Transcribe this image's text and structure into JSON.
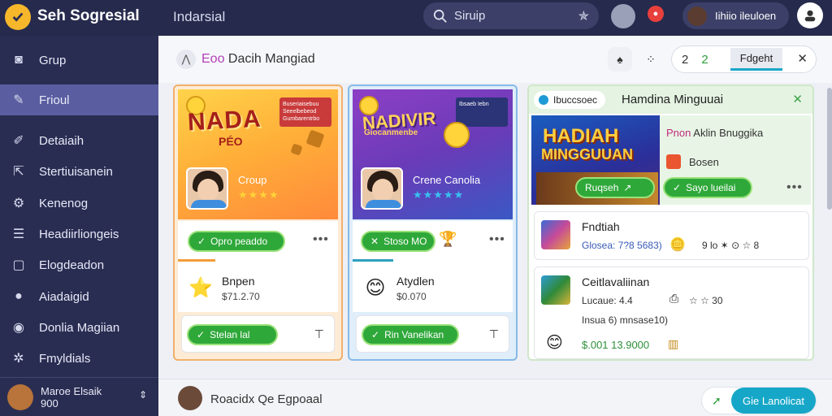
{
  "topbar": {
    "app_title": "Seh Sogresial",
    "breadcrumb": "Indarsial",
    "search_placeholder": "Siruip",
    "user_name": "Iihiio ileuloen"
  },
  "sidebar": {
    "items": [
      {
        "label": "Grup",
        "icon": "camera-icon"
      },
      {
        "label": "Frioul",
        "icon": "pen-icon"
      },
      {
        "label": "Detaiaih",
        "icon": "pencil-icon"
      },
      {
        "label": "Stertiuisanein",
        "icon": "export-icon"
      },
      {
        "label": "Kenenog",
        "icon": "gear-icon"
      },
      {
        "label": "Headiirliongeis",
        "icon": "list-icon"
      },
      {
        "label": "Elogdeadon",
        "icon": "box-icon"
      },
      {
        "label": "Aiadaigid",
        "icon": "drop-icon"
      },
      {
        "label": "Donlia Magiian",
        "icon": "globe-icon"
      },
      {
        "label": "Fmyldials",
        "icon": "settings-icon"
      }
    ],
    "user": {
      "line1": "Maroe Elsaik",
      "line2": "900"
    }
  },
  "header": {
    "prefix": "Eoo",
    "title": "Dacih Mangiad",
    "seg_a": "2",
    "seg_b": "2",
    "seg_tab": "Fdgeht"
  },
  "cards": [
    {
      "banner_word": "NADA",
      "banner_sub": "PÉO",
      "banner_tag": "Buseriaisebuu Seeelbebeod Gumbarentrbo",
      "name": "Croup",
      "stars": "★★★★",
      "action": "Opro peaddo",
      "row_title": "Bnpen",
      "row_value": "$71.2.70",
      "foot_action": "Stelan lal",
      "accent": "#f29d39"
    },
    {
      "banner_word": "NADIVIR",
      "banner_sub": "Giocanmenbe",
      "banner_tag": "Ibsaeb Iebn",
      "name": "Crene Canolia",
      "stars": "★★★★★",
      "action": "Stoso MO",
      "row_title": "Atydlen",
      "row_value": "$0.070",
      "foot_action": "Rin Vanelikan",
      "accent": "#2d9fc0"
    }
  ],
  "card3": {
    "chip": "Ibuccsoec",
    "title": "Hamdina Minguuai",
    "banner_w1": "HADIAH",
    "banner_w2": "MINGGUUAN",
    "panel_line1_a": "Pnon",
    "panel_line1_b": "Aklin Bnuggika",
    "panel_line2": "Bosen",
    "panel_btn_a": "Ruqseh",
    "panel_btn_b": "Sayo lueilai",
    "row1": {
      "title": "Fndtiah",
      "sub": "Glosea: 7?8 5683)",
      "meta": "9 lo ✶ ⊙ ☆ 8"
    },
    "row2": {
      "title": "Ceitlavaliinan",
      "sub": "Lucaue: 4.4",
      "sub2": "Insua 6) mnsase10)",
      "stars": "☆ ☆ 30",
      "money": "$.001 13.9000"
    }
  },
  "bottom": {
    "text": "Roacidx Qe Egpoaal",
    "button": "Gie Lanolicat"
  }
}
